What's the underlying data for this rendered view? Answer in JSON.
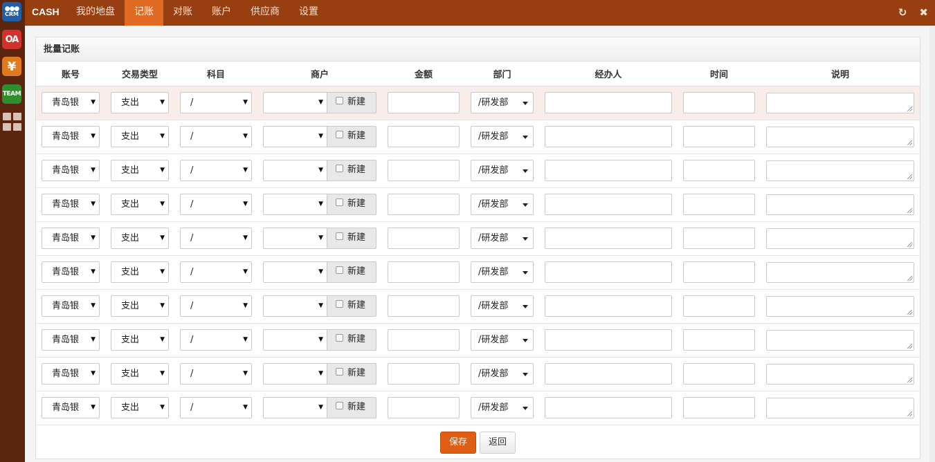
{
  "apps": [
    {
      "name": "CRM",
      "label": "CRM"
    },
    {
      "name": "OA",
      "label": "OA"
    },
    {
      "name": "cash",
      "label": "¥"
    },
    {
      "name": "TEAM",
      "label": "TEAM"
    }
  ],
  "header": {
    "brand": "CASH",
    "nav": [
      "我的地盘",
      "记账",
      "对账",
      "账户",
      "供应商",
      "设置"
    ],
    "active_nav": "记账",
    "refresh_icon": "↻",
    "close_icon": "✖"
  },
  "panel": {
    "title": "批量记账",
    "columns": [
      "账号",
      "交易类型",
      "科目",
      "商户",
      "金额",
      "部门",
      "经办人",
      "时间",
      "说明"
    ]
  },
  "rows": [
    {
      "account": "青岛银",
      "type": "支出",
      "subject": "/",
      "merchant": "",
      "new_label": "新建",
      "amount": "",
      "dept": "/研发部",
      "handler": "",
      "time": "",
      "note": ""
    },
    {
      "account": "青岛银",
      "type": "支出",
      "subject": "/",
      "merchant": "",
      "new_label": "新建",
      "amount": "",
      "dept": "/研发部",
      "handler": "",
      "time": "",
      "note": ""
    },
    {
      "account": "青岛银",
      "type": "支出",
      "subject": "/",
      "merchant": "",
      "new_label": "新建",
      "amount": "",
      "dept": "/研发部",
      "handler": "",
      "time": "",
      "note": ""
    },
    {
      "account": "青岛银",
      "type": "支出",
      "subject": "/",
      "merchant": "",
      "new_label": "新建",
      "amount": "",
      "dept": "/研发部",
      "handler": "",
      "time": "",
      "note": ""
    },
    {
      "account": "青岛银",
      "type": "支出",
      "subject": "/",
      "merchant": "",
      "new_label": "新建",
      "amount": "",
      "dept": "/研发部",
      "handler": "",
      "time": "",
      "note": ""
    },
    {
      "account": "青岛银",
      "type": "支出",
      "subject": "/",
      "merchant": "",
      "new_label": "新建",
      "amount": "",
      "dept": "/研发部",
      "handler": "",
      "time": "",
      "note": ""
    },
    {
      "account": "青岛银",
      "type": "支出",
      "subject": "/",
      "merchant": "",
      "new_label": "新建",
      "amount": "",
      "dept": "/研发部",
      "handler": "",
      "time": "",
      "note": ""
    },
    {
      "account": "青岛银",
      "type": "支出",
      "subject": "/",
      "merchant": "",
      "new_label": "新建",
      "amount": "",
      "dept": "/研发部",
      "handler": "",
      "time": "",
      "note": ""
    },
    {
      "account": "青岛银",
      "type": "支出",
      "subject": "/",
      "merchant": "",
      "new_label": "新建",
      "amount": "",
      "dept": "/研发部",
      "handler": "",
      "time": "",
      "note": ""
    },
    {
      "account": "青岛银",
      "type": "支出",
      "subject": "/",
      "merchant": "",
      "new_label": "新建",
      "amount": "",
      "dept": "/研发部",
      "handler": "",
      "time": "",
      "note": ""
    }
  ],
  "actions": {
    "save": "保存",
    "back": "返回"
  },
  "colors": {
    "topbar": "#983f11",
    "active_tab": "#e06a21",
    "rail": "#5b2510",
    "save": "#e05d14"
  }
}
